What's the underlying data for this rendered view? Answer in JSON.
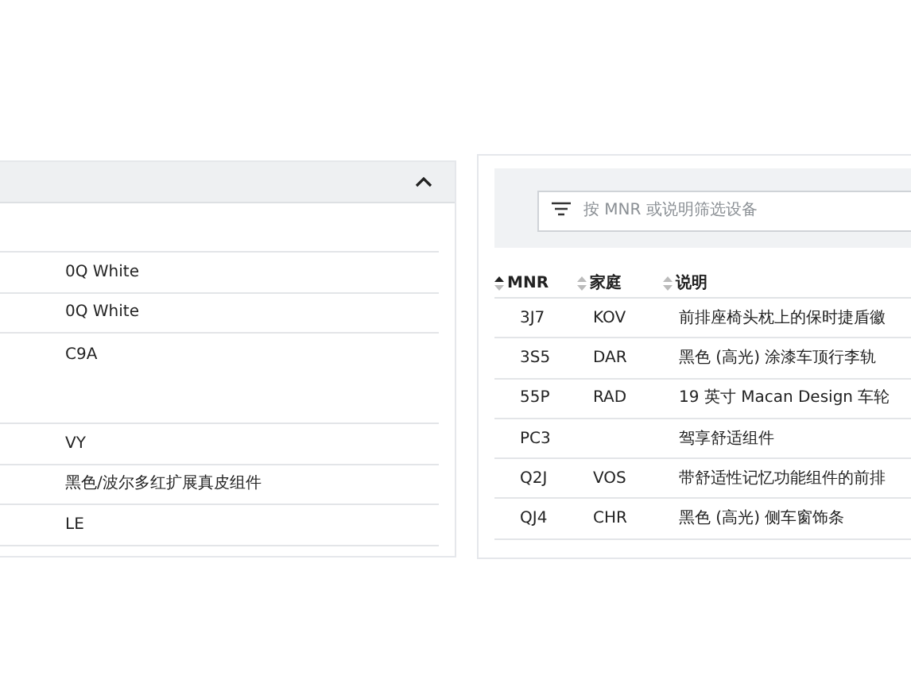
{
  "left_panel": {
    "expanded": true,
    "rows": [
      {
        "value": ""
      },
      {
        "value": "0Q White"
      },
      {
        "value": "0Q White"
      },
      {
        "value": "C9A",
        "tall": true
      },
      {
        "value": "VY"
      },
      {
        "value": "黑色/波尔多红扩展真皮组件"
      },
      {
        "value": "LE"
      }
    ]
  },
  "right_panel": {
    "filter": {
      "placeholder": "按 MNR 或说明筛选设备"
    },
    "columns": [
      {
        "label": "MNR",
        "sorted": true
      },
      {
        "label": "家庭",
        "sorted": false
      },
      {
        "label": "说明",
        "sorted": false
      }
    ],
    "rows": [
      [
        "3J7",
        "KOV",
        "前排座椅头枕上的保时捷盾徽"
      ],
      [
        "3S5",
        "DAR",
        "黑色 (高光) 涂漆车顶行李轨"
      ],
      [
        "55P",
        "RAD",
        "19 英寸 Macan Design 车轮"
      ],
      [
        "PC3",
        "",
        "驾享舒适组件"
      ],
      [
        "Q2J",
        "VOS",
        "带舒适性记忆功能组件的前排"
      ],
      [
        "QJ4",
        "CHR",
        "黑色 (高光) 侧车窗饰条"
      ]
    ]
  }
}
